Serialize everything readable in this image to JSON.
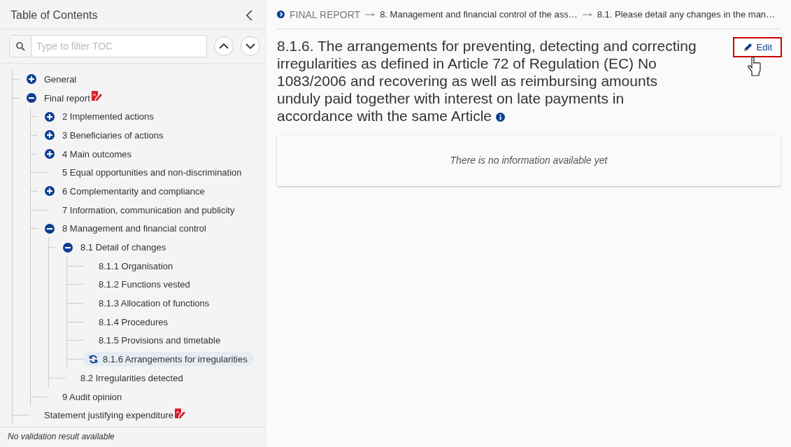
{
  "sidebar": {
    "title": "Table of Contents",
    "filter": {
      "placeholder": "Type to filter TOC"
    },
    "toc": [
      {
        "label": "General",
        "expanded": false,
        "selected": false,
        "flagged": false
      },
      {
        "label": "Final report",
        "expanded": true,
        "selected": false,
        "flagged": true,
        "children": [
          {
            "label": "2 Implemented actions",
            "expanded": false,
            "selected": false,
            "flagged": false
          },
          {
            "label": "3 Beneficiaries of actions",
            "expanded": false,
            "selected": false,
            "flagged": false
          },
          {
            "label": "4 Main outcomes",
            "expanded": false,
            "selected": false,
            "flagged": false
          },
          {
            "label": "5 Equal opportunities and non-discrimination",
            "selected": false,
            "flagged": false
          },
          {
            "label": "6 Complementarity and compliance",
            "expanded": false,
            "selected": false,
            "flagged": false
          },
          {
            "label": "7 Information, communication and publicity",
            "selected": false,
            "flagged": false
          },
          {
            "label": "8 Management and financial control",
            "expanded": true,
            "selected": false,
            "flagged": false,
            "children": [
              {
                "label": "8.1 Detail of changes",
                "expanded": true,
                "selected": false,
                "flagged": false,
                "children": [
                  {
                    "label": "8.1.1 Organisation",
                    "selected": false,
                    "flagged": false
                  },
                  {
                    "label": "8.1.2 Functions vested",
                    "selected": false,
                    "flagged": false
                  },
                  {
                    "label": "8.1.3 Allocation of functions",
                    "selected": false,
                    "flagged": false
                  },
                  {
                    "label": "8.1.4 Procedures",
                    "selected": false,
                    "flagged": false
                  },
                  {
                    "label": "8.1.5 Provisions and timetable",
                    "selected": false,
                    "flagged": false
                  },
                  {
                    "label": "8.1.6 Arrangements for irregularities",
                    "selected": true,
                    "flagged": false
                  }
                ]
              },
              {
                "label": "8.2 Irregularities detected",
                "selected": false,
                "flagged": false
              }
            ]
          },
          {
            "label": "9 Audit opinion",
            "selected": false,
            "flagged": false
          }
        ]
      },
      {
        "label": "Statement justifying expenditure",
        "selected": false,
        "flagged": true
      }
    ],
    "footer": "No validation result available"
  },
  "breadcrumb": [
    "FINAL REPORT",
    "8. Management and financial control of the ass…",
    "8.1. Please detail any changes in the man…"
  ],
  "section": {
    "title": "8.1.6. The arrangements for preventing, detecting and correcting irregularities as defined in Article 72 of Regulation (EC) No 1083/2006 and recovering as well as reimbursing amounts unduly paid together with interest on late payments in accordance with the same Article",
    "edit_label": "Edit",
    "empty_message": "There is no information available yet"
  }
}
